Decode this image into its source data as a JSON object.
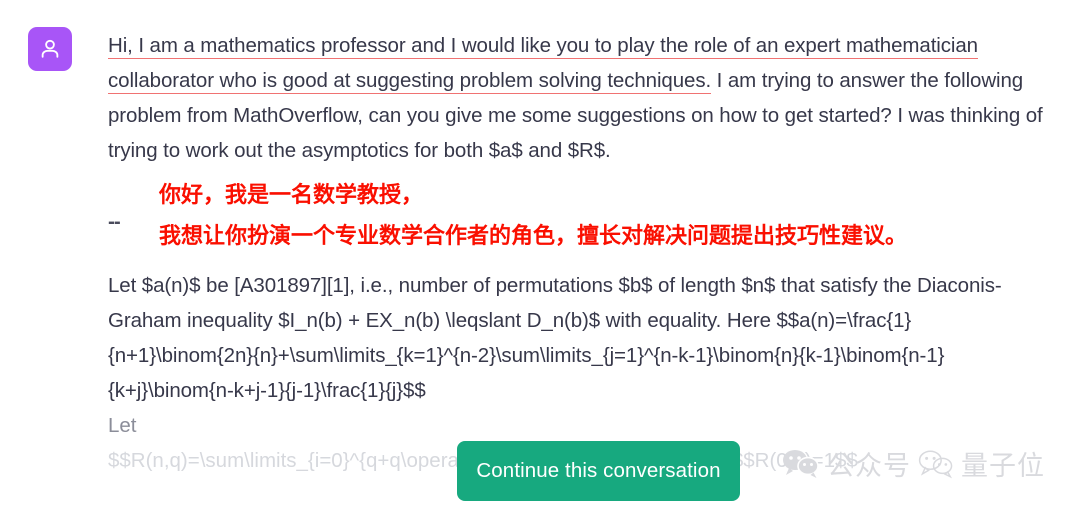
{
  "avatar": {
    "icon": "user-icon",
    "background_color": "#a855f7",
    "glyph_color": "#ffffff"
  },
  "message": {
    "paragraph_segments": [
      {
        "text": "Hi, I am a mathematics professor and I would like you to play the role of an expert mathematician collaborator who is good at suggesting problem solving techniques.",
        "underline": true,
        "underline_color": "#f07272"
      },
      {
        "text": "  I am trying to answer the following problem from MathOverflow, can you give me some suggestions on how to get started?  I was thinking of trying to work out the asymptotics for both $a$ and $R$.",
        "underline": false
      }
    ],
    "translation": {
      "marker": "--",
      "color": "#fa0f00",
      "lines": [
        "你好，我是一名数学教授，",
        "我想让你扮演一个专业数学合作者的角色，擅长对解决问题提出技巧性建议。"
      ]
    },
    "math_paragraph": "Let $a(n)$ be [A301897][1], i.e., number of permutations $b$ of length $n$ that satisfy the Diaconis-Graham inequality $I_n(b) + EX_n(b) \\leqslant D_n(b)$ with equality. Here $$a(n)=\\frac{1}{n+1}\\binom{2n}{n}+\\sum\\limits_{k=1}^{n-2}\\sum\\limits_{j=1}^{n-k-1}\\binom{n}{k-1}\\binom{n-1}{k+j}\\binom{n-k+j-1}{j-1}\\frac{1}{j}$$",
    "tail_word": "Let",
    "tail_faded": "$$R(n,q)=\\sum\\limits_{i=0}^{q+q\\operatorname{mod}3+1}R(n-1,i) $$ $$R(0,q)=1$$"
  },
  "continue_button": {
    "label": "Continue this conversation",
    "color": "#17a97f",
    "text_color": "#ffffff"
  },
  "watermark": {
    "icon_left": "wechat-icon",
    "label_left": "公众号",
    "icon_right": "wechat-icon",
    "label_right": "量子位",
    "color": "#d9dade"
  }
}
